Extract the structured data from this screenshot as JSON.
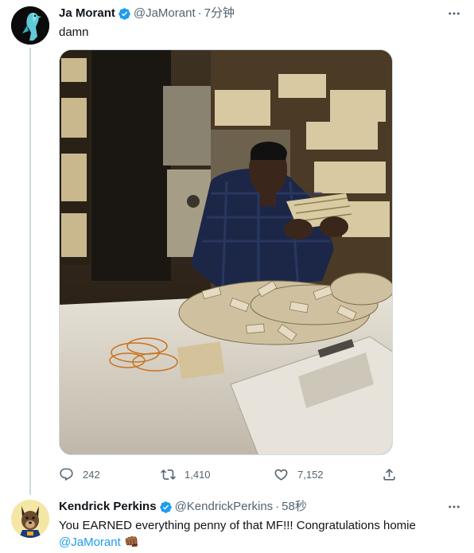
{
  "tweets": [
    {
      "author": {
        "name": "Ja Morant",
        "handle": "@JaMorant",
        "verified": true
      },
      "time": "7分钟",
      "text": "damn",
      "media": {
        "type": "photo"
      },
      "stats": {
        "replies": "242",
        "retweets": "1,410",
        "likes": "7,152"
      }
    },
    {
      "author": {
        "name": "Kendrick Perkins",
        "handle": "@KendrickPerkins",
        "verified": true
      },
      "time": "58秒",
      "text": "You EARNED everything penny of that MF!!! Congratulations homie",
      "mention": "@JaMorant",
      "emoji": "👊🏾"
    }
  ],
  "icons": {
    "verified": "verified-badge-icon",
    "more": "more-horizontal-icon",
    "reply": "reply-icon",
    "retweet": "retweet-icon",
    "like": "heart-icon",
    "share": "share-icon"
  },
  "colors": {
    "accent": "#1d9bf0",
    "text": "#0f1419",
    "muted": "#536471",
    "border": "#cfd9de"
  }
}
